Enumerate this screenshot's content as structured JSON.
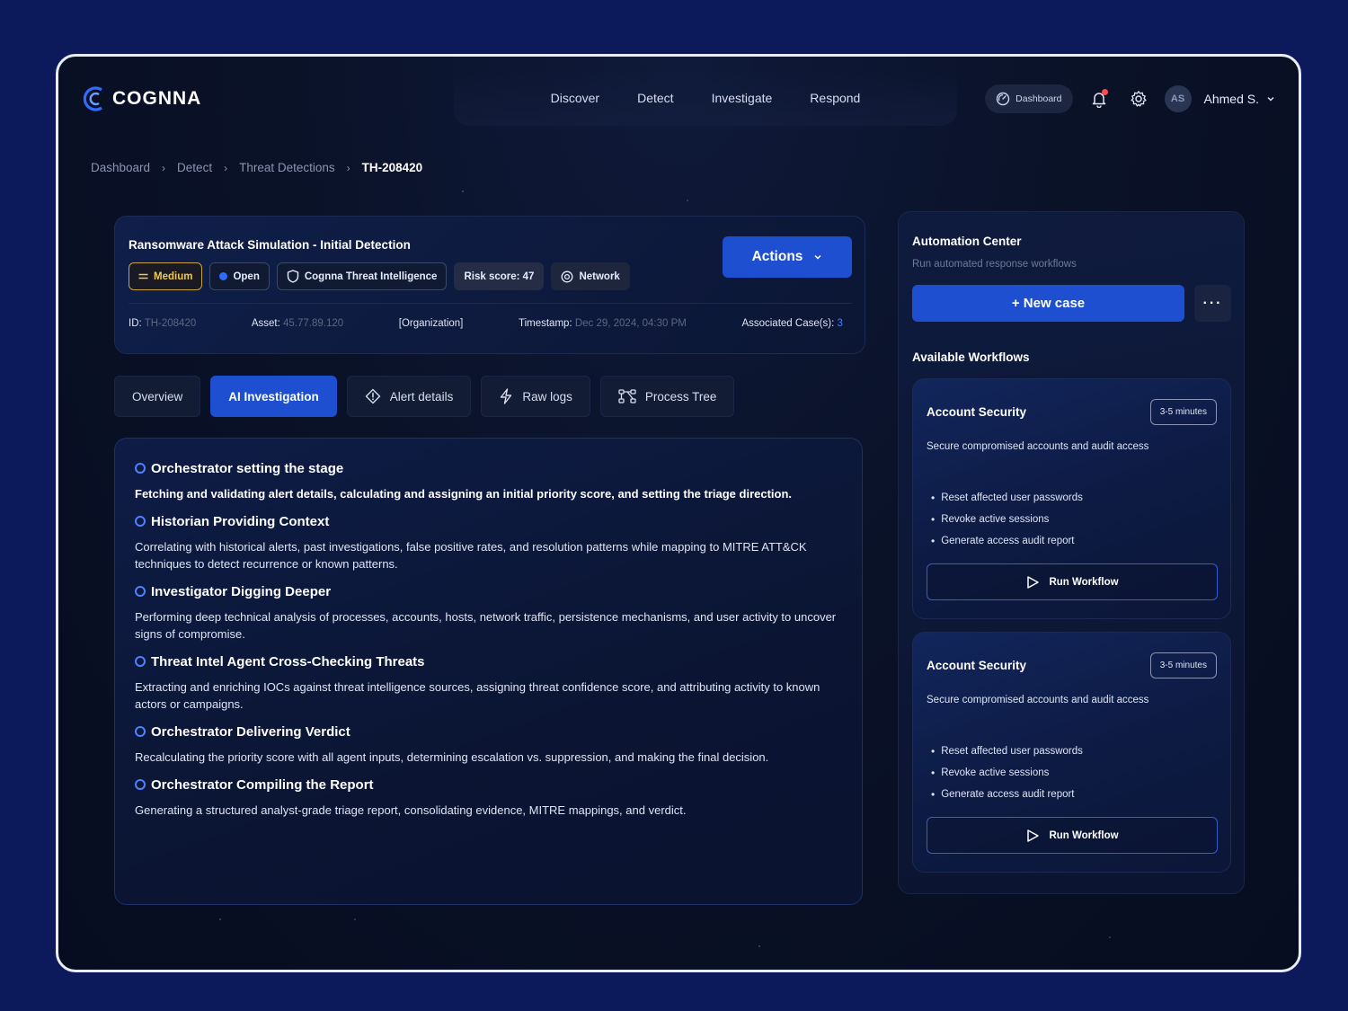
{
  "header": {
    "logo_text": "COGNNA",
    "nav": [
      "Discover",
      "Detect",
      "Investigate",
      "Respond"
    ],
    "dashboard_pill": "Dashboard",
    "user_initials": "AS",
    "user_name": "Ahmed S."
  },
  "breadcrumb": {
    "items": [
      "Dashboard",
      "Detect",
      "Threat Detections"
    ],
    "current": "TH-208420"
  },
  "detection": {
    "title": "Ransomware Attack Simulation - Initial Detection",
    "tags": {
      "severity": "Medium",
      "status": "Open",
      "source": "Cognna Threat Intelligence",
      "risk": "Risk score: 47",
      "category": "Network"
    },
    "actions_label": "Actions",
    "meta": {
      "id_label": "ID:",
      "id_value": "TH-208420",
      "asset_label": "Asset:",
      "asset_value": "45.77.89.120",
      "org": "[Organization]",
      "timestamp_label": "Timestamp:",
      "timestamp_value": "Dec 29, 2024, 04:30 PM",
      "cases_label": "Associated Case(s):",
      "cases_value": "3"
    }
  },
  "tabs": [
    "Overview",
    "AI Investigation",
    "Alert details",
    "Raw logs",
    "Process Tree"
  ],
  "steps": [
    {
      "title": "Orchestrator setting the stage",
      "desc": "Fetching and validating alert details, calculating and assigning an initial priority score, and setting the triage direction."
    },
    {
      "title": "Historian Providing Context",
      "desc": "Correlating with historical alerts, past investigations, false positive rates, and resolution patterns while mapping to MITRE ATT&CK techniques to detect recurrence or known patterns."
    },
    {
      "title": "Investigator Digging Deeper",
      "desc": "Performing deep technical analysis of processes, accounts, hosts, network traffic, persistence mechanisms, and user activity to uncover signs of compromise."
    },
    {
      "title": "Threat Intel Agent Cross-Checking Threats",
      "desc": "Extracting and enriching IOCs against threat intelligence sources, assigning threat confidence score, and attributing activity to known actors or campaigns."
    },
    {
      "title": "Orchestrator Delivering Verdict",
      "desc": "Recalculating the priority score with all agent inputs, determining escalation vs. suppression, and making the final decision."
    },
    {
      "title": "Orchestrator Compiling the Report",
      "desc": "Generating a structured analyst-grade triage report, consolidating evidence, MITRE mappings, and verdict."
    }
  ],
  "automation": {
    "title": "Automation Center",
    "subtitle": "Run automated response workflows",
    "new_case_label": "+ New case",
    "more_label": "···",
    "workflows_heading": "Available Workflows",
    "workflows": [
      {
        "name": "Account Security",
        "time": "3-5 minutes",
        "desc": "Secure compromised accounts and audit access",
        "steps": [
          "Reset affected user passwords",
          "Revoke active sessions",
          "Generate access audit report"
        ],
        "run_label": "Run Workflow"
      },
      {
        "name": "Account Security",
        "time": "3-5 minutes",
        "desc": "Secure compromised accounts and audit access",
        "steps": [
          "Reset affected user passwords",
          "Revoke active sessions",
          "Generate access audit report"
        ],
        "run_label": "Run Workflow"
      }
    ]
  },
  "colors": {
    "accent": "#1d4fd0",
    "background": "#0c1a5c",
    "severity_medium": "#f2c84b",
    "notification": "#ff4a4a"
  }
}
